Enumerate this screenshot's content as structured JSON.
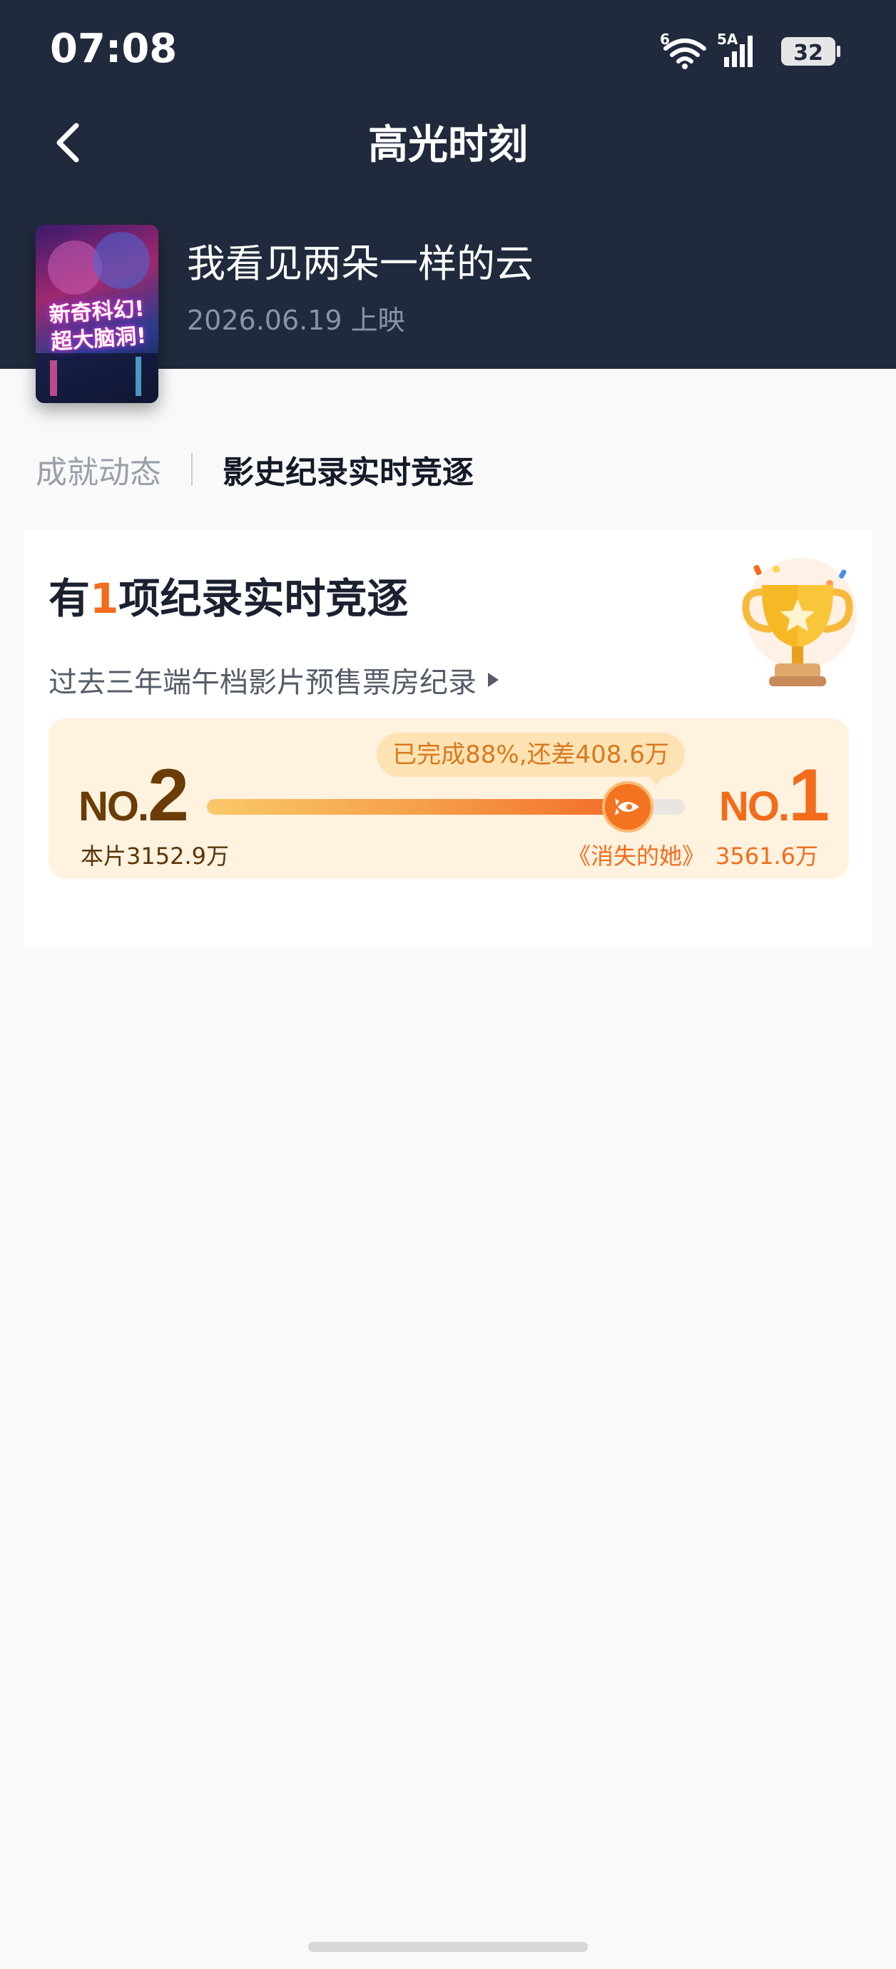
{
  "status_bar": {
    "time": "07:08",
    "wifi_label": "6",
    "signal_label": "5A",
    "battery": "32"
  },
  "nav": {
    "title": "高光时刻",
    "back_icon": "chevron-left-icon"
  },
  "movie": {
    "title": "我看见两朵一样的云",
    "release": "2026.06.19 上映",
    "poster_text_line1": "新奇科幻!",
    "poster_text_line2": "超大脑洞!"
  },
  "tabs": [
    {
      "label": "成就动态",
      "active": false
    },
    {
      "label": "影史纪录实时竞逐",
      "active": true
    }
  ],
  "card": {
    "heading_prefix": "有",
    "heading_count": "1",
    "heading_suffix": "项纪录实时竞逐",
    "record_name": "过去三年端午档影片预售票房纪录",
    "race": {
      "tip": "已完成88%,还差408.6万",
      "progress_percent": 88,
      "self_rank_prefix": "NO.",
      "self_rank": "2",
      "self_value": "本片3152.9万",
      "rival_rank_prefix": "NO.",
      "rival_rank": "1",
      "rival_name": "《消失的她》",
      "rival_value": "3561.6万"
    }
  },
  "colors": {
    "header_bg": "#202a3c",
    "accent_orange": "#f26c1c",
    "race_bg": "#fff2df"
  }
}
